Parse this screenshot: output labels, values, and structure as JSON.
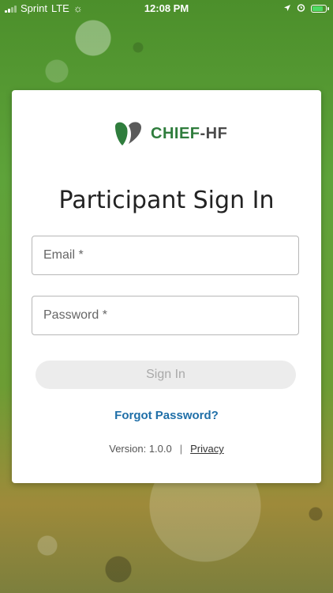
{
  "status_bar": {
    "carrier": "Sprint",
    "network": "LTE",
    "time": "12:08 PM"
  },
  "logo": {
    "name_part1": "CHIEF",
    "name_part2": "-HF"
  },
  "colors": {
    "brand_green": "#2f7d3d",
    "link_blue": "#1f6fa8"
  },
  "title": "Participant Sign In",
  "form": {
    "email_placeholder": "Email *",
    "email_value": "",
    "password_placeholder": "Password *",
    "password_value": "",
    "signin_label": "Sign In"
  },
  "forgot_label": "Forgot Password?",
  "footer": {
    "version": "Version: 1.0.0",
    "separator": "|",
    "privacy_label": "Privacy"
  }
}
